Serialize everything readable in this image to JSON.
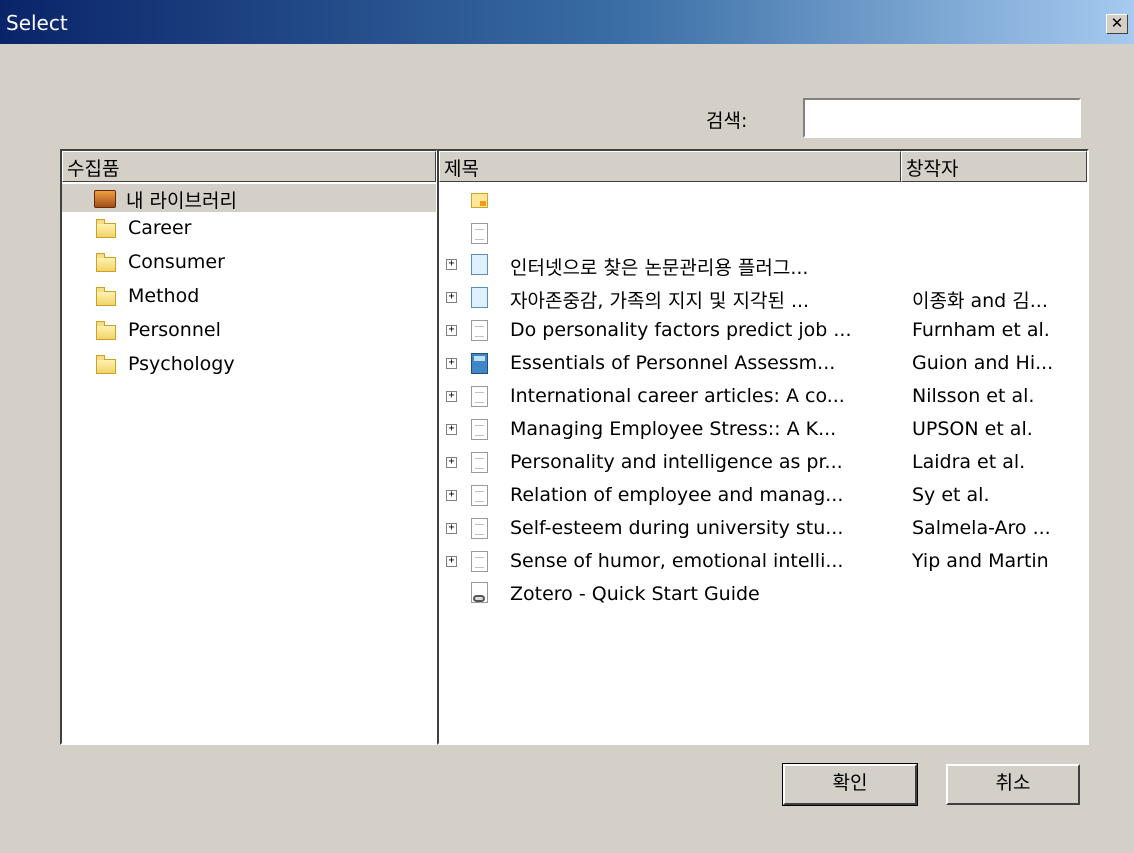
{
  "window": {
    "title": "Select",
    "close_glyph": "✕"
  },
  "search": {
    "label": "검색:",
    "value": "",
    "placeholder": ""
  },
  "collections": {
    "header": "수집품",
    "items": [
      {
        "label": "내 라이브러리",
        "icon": "library-icon",
        "selected": true
      },
      {
        "label": "Career",
        "icon": "folder-icon"
      },
      {
        "label": "Consumer",
        "icon": "folder-icon"
      },
      {
        "label": "Method",
        "icon": "folder-icon"
      },
      {
        "label": "Personnel",
        "icon": "folder-icon"
      },
      {
        "label": "Psychology",
        "icon": "folder-icon"
      }
    ]
  },
  "items": {
    "headers": {
      "title": "제목",
      "creator": "창작자"
    },
    "rows": [
      {
        "icon": "note-icon",
        "title": "",
        "creator": "",
        "expandable": false
      },
      {
        "icon": "document-icon",
        "title": "",
        "creator": "",
        "expandable": false
      },
      {
        "icon": "web-page-icon",
        "title": "인터넷으로 찾은 논문관리용 플러그...",
        "creator": "",
        "expandable": true
      },
      {
        "icon": "web-page-icon",
        "title": "자아존중감, 가족의 지지 및 지각된 ...",
        "creator": "이종화 and 김...",
        "expandable": true
      },
      {
        "icon": "document-icon",
        "title": "Do personality factors predict job ...",
        "creator": "Furnham et al.",
        "expandable": true
      },
      {
        "icon": "book-icon",
        "title": "Essentials of Personnel Assessm...",
        "creator": "Guion and Hi...",
        "expandable": true
      },
      {
        "icon": "document-icon",
        "title": "International career articles: A co...",
        "creator": "Nilsson et al.",
        "expandable": true
      },
      {
        "icon": "document-icon",
        "title": "Managing Employee Stress:: A K...",
        "creator": "UPSON et al.",
        "expandable": true
      },
      {
        "icon": "document-icon",
        "title": "Personality and intelligence as pr...",
        "creator": "Laidra et al.",
        "expandable": true
      },
      {
        "icon": "document-icon",
        "title": "Relation of employee and manag...",
        "creator": "Sy et al.",
        "expandable": true
      },
      {
        "icon": "document-icon",
        "title": "Self-esteem during university stu...",
        "creator": "Salmela-Aro ...",
        "expandable": true
      },
      {
        "icon": "document-icon",
        "title": "Sense of humor, emotional intelli...",
        "creator": "Yip and Martin",
        "expandable": true
      },
      {
        "icon": "link-icon",
        "title": "Zotero - Quick Start Guide",
        "creator": "",
        "expandable": false
      }
    ]
  },
  "buttons": {
    "ok": "확인",
    "cancel": "취소"
  }
}
